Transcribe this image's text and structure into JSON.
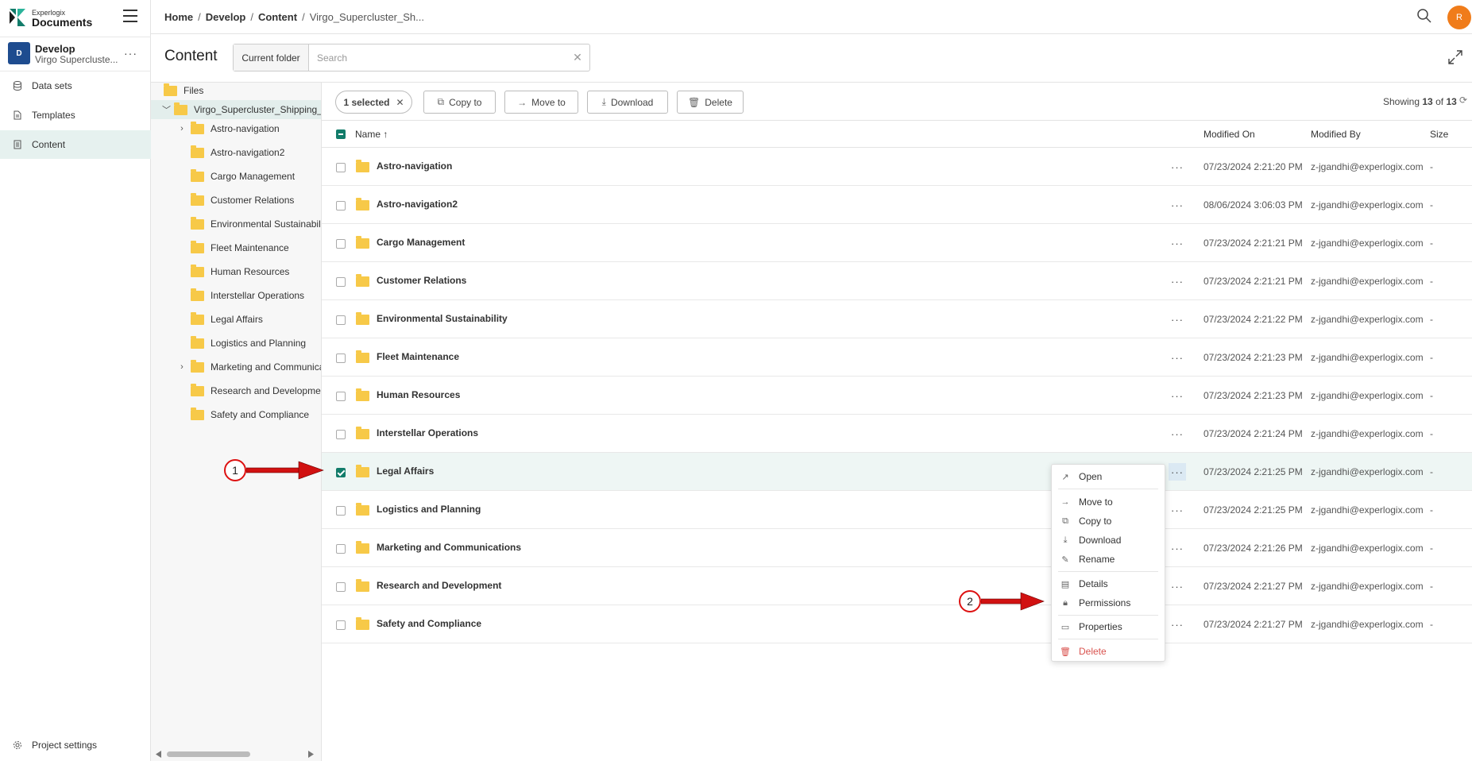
{
  "app": {
    "brand": "Experlogix",
    "product": "Documents"
  },
  "project": {
    "avatar": "D",
    "name": "Develop",
    "subtitle": "Virgo Supercluste..."
  },
  "nav": {
    "items": [
      {
        "label": "Data sets",
        "icon": "database-icon"
      },
      {
        "label": "Templates",
        "icon": "file-icon"
      },
      {
        "label": "Content",
        "icon": "content-icon",
        "active": true
      }
    ],
    "settings": "Project settings"
  },
  "breadcrumb": {
    "home": "Home",
    "develop": "Develop",
    "content": "Content",
    "current": "Virgo_Supercluster_Sh..."
  },
  "user": {
    "initial": "R"
  },
  "page": {
    "title": "Content"
  },
  "search": {
    "scope": "Current folder",
    "placeholder": "Search"
  },
  "tree": {
    "root": "Files",
    "folder": "Virgo_Supercluster_Shipping_S",
    "children": [
      "Astro-navigation",
      "Astro-navigation2",
      "Cargo Management",
      "Customer Relations",
      "Environmental Sustainability",
      "Fleet Maintenance",
      "Human Resources",
      "Interstellar Operations",
      "Legal Affairs",
      "Logistics and Planning",
      "Marketing and Communicati",
      "Research and Development",
      "Safety and Compliance"
    ]
  },
  "toolbar": {
    "selected": "1 selected",
    "copy": "Copy to",
    "move": "Move to",
    "download": "Download",
    "delete": "Delete",
    "showing_prefix": "Showing",
    "showing_count": "13",
    "showing_of": "of",
    "showing_total": "13"
  },
  "columns": {
    "name": "Name ↑",
    "modified_on": "Modified On",
    "modified_by": "Modified By",
    "size": "Size"
  },
  "rows": [
    {
      "name": "Astro-navigation",
      "modified": "07/23/2024 2:21:20 PM",
      "by": "z-jgandhi@experlogix.com",
      "size": "-"
    },
    {
      "name": "Astro-navigation2",
      "modified": "08/06/2024 3:06:03 PM",
      "by": "z-jgandhi@experlogix.com",
      "size": "-"
    },
    {
      "name": "Cargo Management",
      "modified": "07/23/2024 2:21:21 PM",
      "by": "z-jgandhi@experlogix.com",
      "size": "-"
    },
    {
      "name": "Customer Relations",
      "modified": "07/23/2024 2:21:21 PM",
      "by": "z-jgandhi@experlogix.com",
      "size": "-"
    },
    {
      "name": "Environmental Sustainability",
      "modified": "07/23/2024 2:21:22 PM",
      "by": "z-jgandhi@experlogix.com",
      "size": "-"
    },
    {
      "name": "Fleet Maintenance",
      "modified": "07/23/2024 2:21:23 PM",
      "by": "z-jgandhi@experlogix.com",
      "size": "-"
    },
    {
      "name": "Human Resources",
      "modified": "07/23/2024 2:21:23 PM",
      "by": "z-jgandhi@experlogix.com",
      "size": "-"
    },
    {
      "name": "Interstellar Operations",
      "modified": "07/23/2024 2:21:24 PM",
      "by": "z-jgandhi@experlogix.com",
      "size": "-"
    },
    {
      "name": "Legal Affairs",
      "modified": "07/23/2024 2:21:25 PM",
      "by": "z-jgandhi@experlogix.com",
      "size": "-",
      "selected": true
    },
    {
      "name": "Logistics and Planning",
      "modified": "07/23/2024 2:21:25 PM",
      "by": "z-jgandhi@experlogix.com",
      "size": "-"
    },
    {
      "name": "Marketing and Communications",
      "modified": "07/23/2024 2:21:26 PM",
      "by": "z-jgandhi@experlogix.com",
      "size": "-"
    },
    {
      "name": "Research and Development",
      "modified": "07/23/2024 2:21:27 PM",
      "by": "z-jgandhi@experlogix.com",
      "size": "-"
    },
    {
      "name": "Safety and Compliance",
      "modified": "07/23/2024 2:21:27 PM",
      "by": "z-jgandhi@experlogix.com",
      "size": "-"
    }
  ],
  "context_menu": {
    "open": "Open",
    "move": "Move to",
    "copy": "Copy to",
    "download": "Download",
    "rename": "Rename",
    "details": "Details",
    "permissions": "Permissions",
    "properties": "Properties",
    "delete": "Delete"
  },
  "annotations": {
    "one": "1",
    "two": "2"
  },
  "colors": {
    "accent": "#127c6a",
    "folder": "#f7c948",
    "avatar": "#1e4c8f",
    "user": "#f07c1a",
    "arrow": "#d11111"
  }
}
